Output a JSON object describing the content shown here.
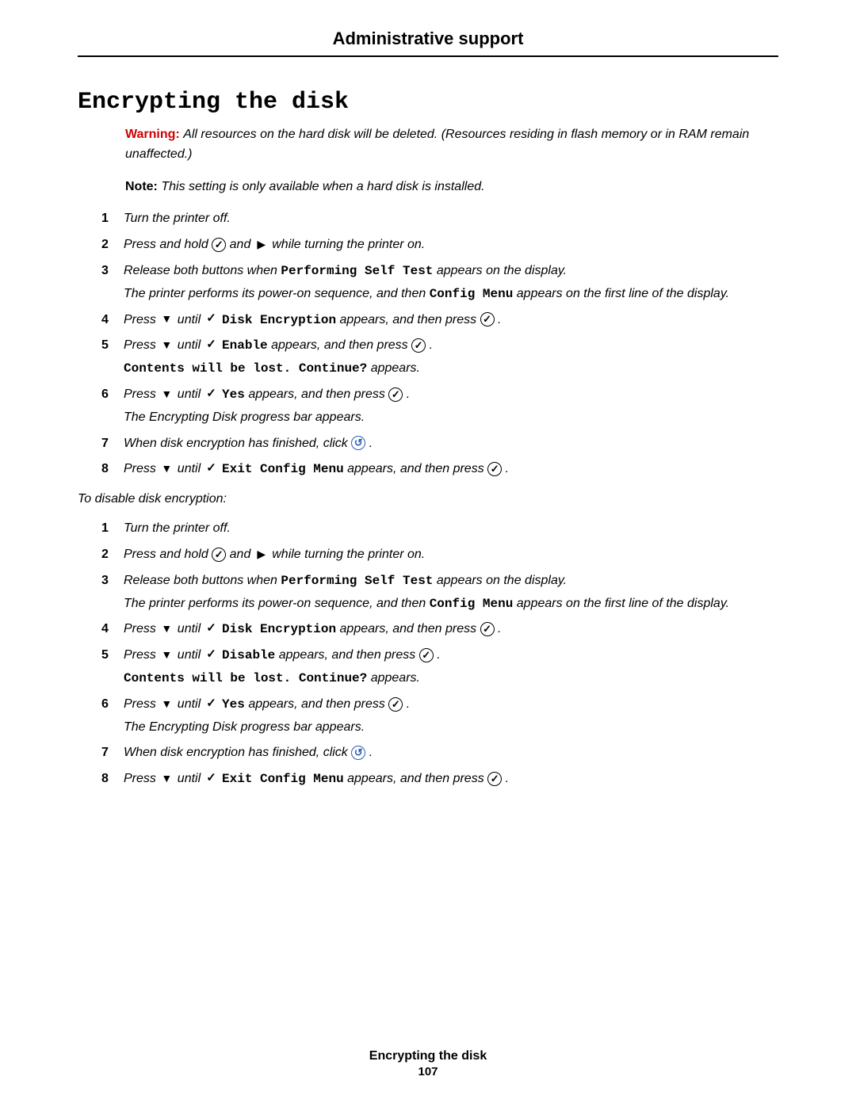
{
  "header": {
    "title": "Administrative support"
  },
  "section": {
    "title": "Encrypting the disk"
  },
  "warning": {
    "label": "Warning:",
    "text": "All resources on the hard disk will be deleted. (Resources residing in flash memory or in RAM remain unaffected.)"
  },
  "note": {
    "label": "Note:",
    "text": "This setting is only available when a hard disk is installed."
  },
  "menu_terms": {
    "self_test": "Performing Self Test",
    "config_menu": "Config Menu",
    "disk_encryption": "Disk Encryption",
    "enable": "Enable",
    "disable": "Disable",
    "yes": "Yes",
    "exit_config": "Exit Config Menu",
    "contents_lost": "Contents will be lost. Continue?"
  },
  "frag": {
    "turn_off": "Turn the printer off.",
    "press_hold": "Press and hold ",
    "and_sp": " and ",
    "while_on": "  while turning the printer on.",
    "release_both": "Release both buttons when ",
    "appears_display": " appears on the display.",
    "poweron_seq": "The printer performs its power-on sequence, and then ",
    "first_line": " appears on the first line of the display.",
    "press_sp": "Press ",
    "until_sp": " until ",
    "appears_then": " appears, and then press ",
    "period": " .",
    "appears_period": " appears.",
    "progress_bar": "The Encrypting Disk progress bar appears.",
    "when_finished": "When disk encryption has finished, click ",
    "disable_intro": "To disable disk encryption:"
  },
  "footer": {
    "title": "Encrypting the disk",
    "page": "107"
  }
}
